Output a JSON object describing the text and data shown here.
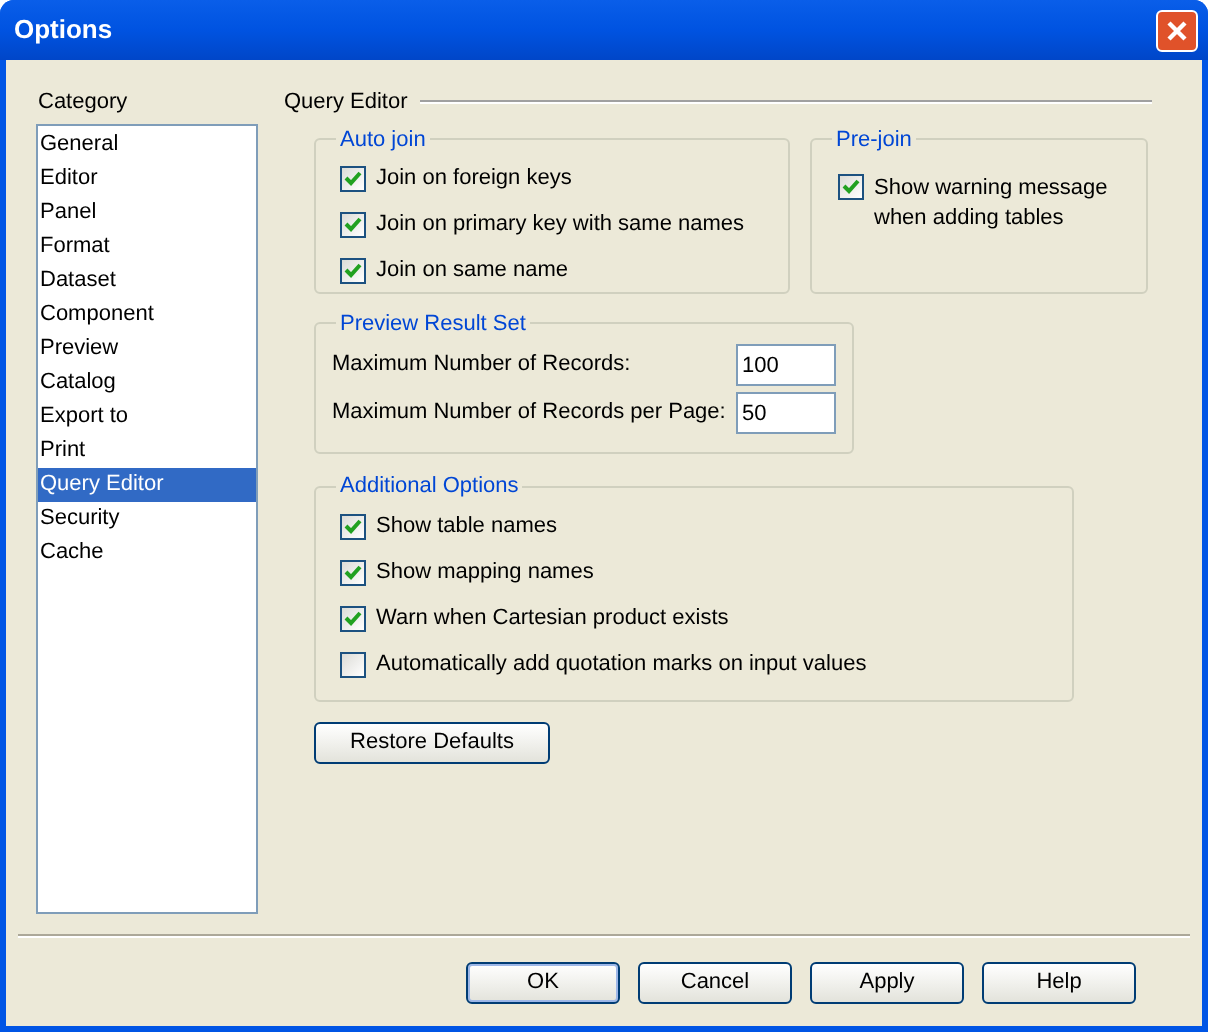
{
  "window": {
    "title": "Options"
  },
  "category": {
    "label": "Category",
    "items": [
      {
        "label": "General",
        "selected": false
      },
      {
        "label": "Editor",
        "selected": false
      },
      {
        "label": "Panel",
        "selected": false
      },
      {
        "label": "Format",
        "selected": false
      },
      {
        "label": "Dataset",
        "selected": false
      },
      {
        "label": "Component",
        "selected": false
      },
      {
        "label": "Preview",
        "selected": false
      },
      {
        "label": "Catalog",
        "selected": false
      },
      {
        "label": "Export to",
        "selected": false
      },
      {
        "label": "Print",
        "selected": false
      },
      {
        "label": "Query Editor",
        "selected": true
      },
      {
        "label": "Security",
        "selected": false
      },
      {
        "label": "Cache",
        "selected": false
      }
    ]
  },
  "page": {
    "title": "Query Editor",
    "auto_join": {
      "title": "Auto join",
      "options": [
        {
          "label": "Join on foreign keys",
          "checked": true
        },
        {
          "label": "Join on primary key with same names",
          "checked": true
        },
        {
          "label": "Join on same name",
          "checked": true
        }
      ]
    },
    "pre_join": {
      "title": "Pre-join",
      "options": [
        {
          "label": "Show warning message when adding tables",
          "checked": true
        }
      ]
    },
    "preview": {
      "title": "Preview Result Set",
      "fields": [
        {
          "label": "Maximum Number of Records:",
          "value": "100"
        },
        {
          "label": "Maximum Number of Records per Page:",
          "value": "50"
        }
      ]
    },
    "additional": {
      "title": "Additional Options",
      "options": [
        {
          "label": "Show table names",
          "checked": true
        },
        {
          "label": "Show mapping names",
          "checked": true
        },
        {
          "label": "Warn when Cartesian product exists",
          "checked": true
        },
        {
          "label": "Automatically add quotation marks on input values",
          "checked": false
        }
      ]
    },
    "restore_button": "Restore Defaults"
  },
  "buttons": [
    "OK",
    "Cancel",
    "Apply",
    "Help"
  ]
}
